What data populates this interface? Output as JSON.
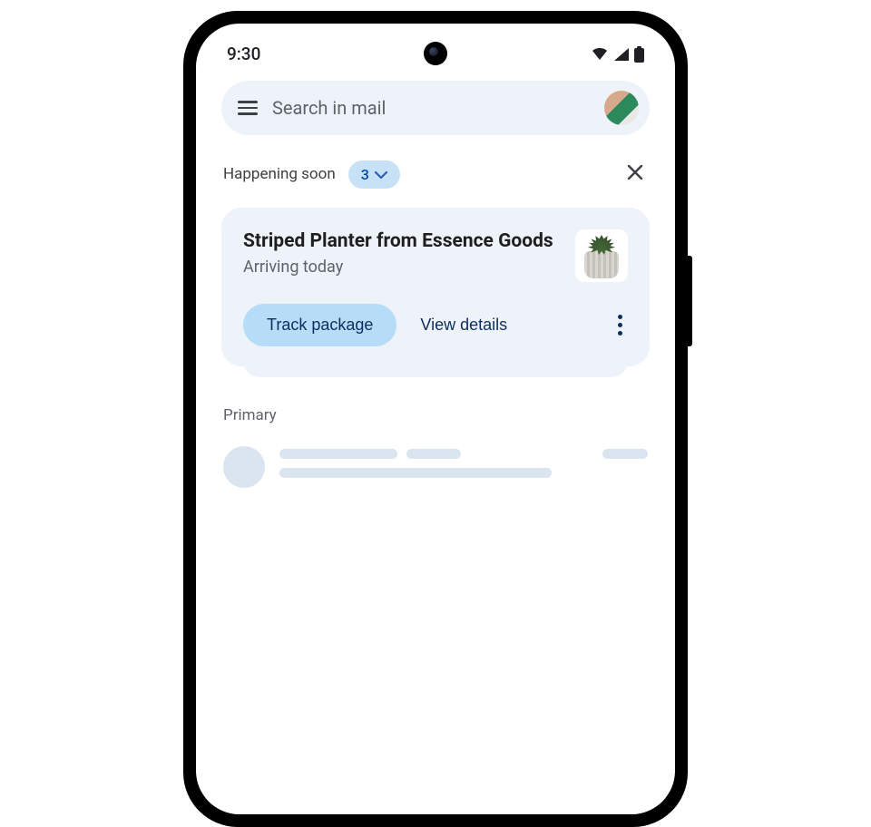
{
  "status": {
    "time": "9:30"
  },
  "search": {
    "placeholder": "Search in mail"
  },
  "happening": {
    "label": "Happening soon",
    "count": "3"
  },
  "card": {
    "title": "Striped Planter from Essence Goods",
    "subtitle": "Arriving today",
    "primary_action": "Track package",
    "secondary_action": "View details"
  },
  "inbox": {
    "section_label": "Primary"
  }
}
